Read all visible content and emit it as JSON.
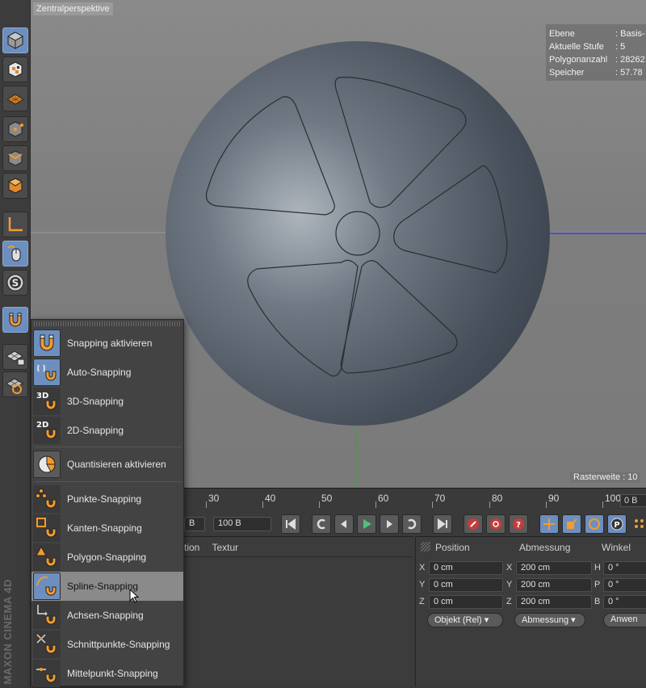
{
  "viewport": {
    "title": "Zentralperspektive",
    "hud": [
      {
        "key": "Ebene",
        "value": ": Basis-"
      },
      {
        "key": "Aktuelle Stufe",
        "value": ": 5"
      },
      {
        "key": "Polygonanzahl",
        "value": ": 28262"
      },
      {
        "key": "Speicher",
        "value": ": 57.78"
      }
    ],
    "raster": "Rasterweite : 10"
  },
  "toolbar": {
    "icons": [
      "cube-model-icon",
      "texture-checker-icon",
      "floor-grid-icon",
      "point-mode-icon",
      "edge-mode-icon",
      "polygon-mode-icon",
      "axis-icon",
      "mouse-tweak-icon",
      "snap-s-icon",
      "magnet-snapping-icon",
      "workplane-lock-icon",
      "workplane-grid-icon"
    ],
    "brand": "MAXON CINEMA 4D"
  },
  "timeline": {
    "ticks": [
      "30",
      "40",
      "50",
      "60",
      "70",
      "80",
      "90",
      "100"
    ],
    "frame": "0 B"
  },
  "transport": {
    "end_frame": "100 B",
    "small_field": "B"
  },
  "objects": {
    "headers": [
      "tion",
      "Textur"
    ]
  },
  "coords": {
    "headers": [
      "Position",
      "Abmessung",
      "Winkel"
    ],
    "rows": [
      {
        "axis": "X",
        "pos": "0 cm",
        "size_axis": "X",
        "size": "200 cm",
        "ang_axis": "H",
        "ang": "0 °"
      },
      {
        "axis": "Y",
        "pos": "0 cm",
        "size_axis": "Y",
        "size": "200 cm",
        "ang_axis": "P",
        "ang": "0 °"
      },
      {
        "axis": "Z",
        "pos": "0 cm",
        "size_axis": "Z",
        "size": "200 cm",
        "ang_axis": "B",
        "ang": "0 °"
      }
    ],
    "mode_select": "Objekt (Rel)",
    "size_select": "Abmessung",
    "apply": "Anwen"
  },
  "menu": {
    "items": [
      {
        "label": "Snapping aktivieren",
        "icon": "magnet-icon"
      },
      {
        "label": "Auto-Snapping",
        "icon": "auto-snap-icon"
      },
      {
        "label": "3D-Snapping",
        "icon": "snap-3d-icon",
        "badge": "3D"
      },
      {
        "label": "2D-Snapping",
        "icon": "snap-2d-icon",
        "badge": "2D"
      },
      {
        "label": "Quantisieren aktivieren",
        "icon": "quantize-icon"
      },
      {
        "label": "Punkte-Snapping",
        "icon": "point-snap-icon"
      },
      {
        "label": "Kanten-Snapping",
        "icon": "edge-snap-icon"
      },
      {
        "label": "Polygon-Snapping",
        "icon": "polygon-snap-icon"
      },
      {
        "label": "Spline-Snapping",
        "icon": "spline-snap-icon"
      },
      {
        "label": "Achsen-Snapping",
        "icon": "axis-snap-icon"
      },
      {
        "label": "Schnittpunkte-Snapping",
        "icon": "intersection-snap-icon"
      },
      {
        "label": "Mittelpunkt-Snapping",
        "icon": "midpoint-snap-icon"
      }
    ],
    "highlighted": "Spline-Snapping"
  },
  "colors": {
    "accent": "#f29b2e",
    "selection_blue": "#6c8fc0",
    "menu_bg": "#434343"
  }
}
